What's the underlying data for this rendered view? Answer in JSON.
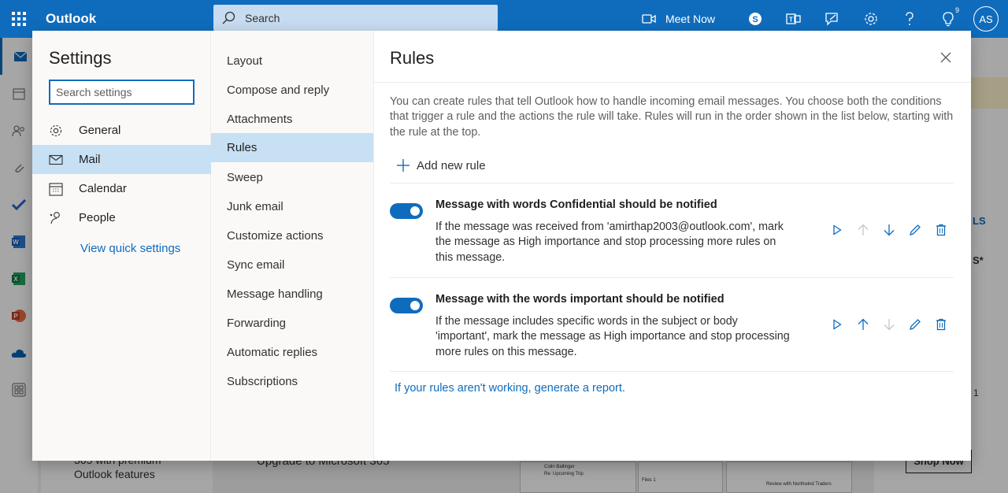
{
  "app": {
    "name": "Outlook",
    "search_placeholder": "Search",
    "meet_now": "Meet Now",
    "tips_badge": "9",
    "avatar_initials": "AS"
  },
  "background": {
    "promo_line1": "365 with premium",
    "promo_line2": "Outlook features",
    "upgrade": "Upgrade to Microsoft 365",
    "shop_now": "Shop Now",
    "side_label1": "LS",
    "side_label2": "S*",
    "side_label3": "1",
    "thumb_name": "Colin Ballinger",
    "thumb_subject": "Re: Upcoming Trip",
    "thumb_files": "Files 1",
    "thumb_review": "Review with Northwind Traders"
  },
  "settings": {
    "title": "Settings",
    "search_placeholder": "Search settings",
    "categories": [
      {
        "label": "General",
        "icon": "gear-icon"
      },
      {
        "label": "Mail",
        "icon": "mail-icon"
      },
      {
        "label": "Calendar",
        "icon": "calendar-icon"
      },
      {
        "label": "People",
        "icon": "people-icon"
      }
    ],
    "selected_category": "Mail",
    "quick_settings_link": "View quick settings"
  },
  "mail_sections": {
    "items": [
      "Layout",
      "Compose and reply",
      "Attachments",
      "Rules",
      "Sweep",
      "Junk email",
      "Customize actions",
      "Sync email",
      "Message handling",
      "Forwarding",
      "Automatic replies",
      "Subscriptions"
    ],
    "selected": "Rules"
  },
  "rules": {
    "title": "Rules",
    "description": "You can create rules that tell Outlook how to handle incoming email messages. You choose both the conditions that trigger a rule and the actions the rule will take. Rules will run in the order shown in the list below, starting with the rule at the top.",
    "add_new_rule": "Add new rule",
    "list": [
      {
        "name": "Message with words Confidential should be notified",
        "description": "If the message was received from 'amirthap2003@outlook.com', mark the message as High importance and stop processing more rules on this message.",
        "enabled": true,
        "move_up_enabled": false,
        "move_down_enabled": true
      },
      {
        "name": "Message with the words important should be notified",
        "description": "If the message includes specific words in the subject or body 'important', mark the message as High importance and stop processing more rules on this message.",
        "enabled": true,
        "move_up_enabled": true,
        "move_down_enabled": false
      }
    ],
    "report_link": "If your rules aren't working, generate a report."
  },
  "colors": {
    "brand": "#0f6cbd",
    "selected_bg": "#c7e0f4",
    "disabled_icon": "#c8c6c4"
  }
}
